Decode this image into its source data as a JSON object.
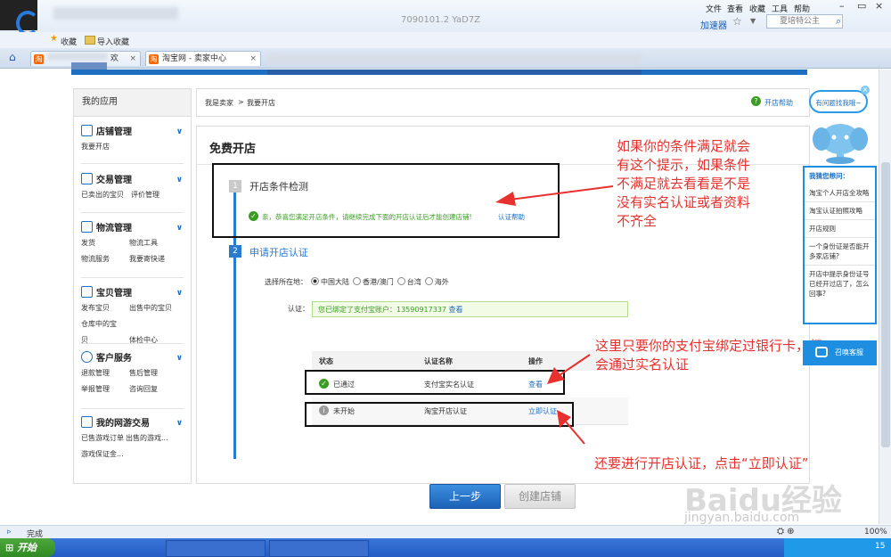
{
  "browser": {
    "menu": [
      "文件",
      "查看",
      "收藏",
      "工具",
      "帮助"
    ],
    "address_partial": "7090101.2 YaD7Z",
    "accelerator_label": "加速器",
    "search_placeholder": "夏培特公主",
    "favorites": [
      "收藏",
      "导入收藏"
    ],
    "tabs": [
      {
        "label": "",
        "active": false
      },
      {
        "label": "欢",
        "active": false
      },
      {
        "label": "淘宝网 - 卖家中心",
        "active": true
      }
    ],
    "status_text": "完成",
    "zoom": "100%"
  },
  "taskbar": {
    "start_label": "开始",
    "clock": "15"
  },
  "sidebar": {
    "title": "我的应用",
    "sections": [
      {
        "title": "店铺管理",
        "links": [
          "我要开店"
        ]
      },
      {
        "title": "交易管理",
        "links": [
          "已卖出的宝贝",
          "评价管理"
        ]
      },
      {
        "title": "物流管理",
        "links": [
          "发货",
          "物流工具",
          "物流服务",
          "我要寄快递"
        ]
      },
      {
        "title": "宝贝管理",
        "links": [
          "发布宝贝",
          "出售中的宝贝",
          "仓库中的宝贝",
          "体检中心"
        ]
      },
      {
        "title": "客户服务",
        "links": [
          "退款管理",
          "售后管理",
          "举报管理",
          "咨询回复"
        ]
      },
      {
        "title": "我的网游交易",
        "links": [
          "已售游戏订单",
          "出售的游戏...",
          "游戏保证金..."
        ]
      }
    ]
  },
  "breadcrumb": {
    "part1": "我是卖家",
    "sep": ">",
    "part2": "我要开店",
    "help_label": "开店帮助"
  },
  "main": {
    "title": "免费开店",
    "step1": {
      "num": "1",
      "title": "开店条件检测",
      "message": "亲，恭喜您满足开店条件，请继续完成下面的开店认证后才能创建店铺!",
      "link": "认证帮助"
    },
    "step2": {
      "num": "2",
      "title": "申请开店认证",
      "location_label": "选择所在地：",
      "locations": [
        "中国大陆",
        "香港/澳门",
        "台湾",
        "海外"
      ],
      "auth_label": "认证：",
      "alipay_text": "您已绑定了支付宝账户：13590917337",
      "alipay_link": "查看",
      "table": {
        "headers": [
          "状态",
          "认证名称",
          "操作"
        ],
        "rows": [
          {
            "status": "已通过",
            "name": "支付宝实名认证",
            "action": "查看",
            "icon": "check-circle-icon"
          },
          {
            "status": "未开始",
            "name": "淘宝开店认证",
            "action": "立即认证",
            "icon": "info-circle-icon"
          }
        ]
      }
    },
    "buttons": {
      "prev": "上一步",
      "create": "创建店铺"
    }
  },
  "annotations": {
    "a1": [
      "如果你的条件满足就会",
      "有这个提示，如果条件",
      "不满足就去看看是不是",
      "没有实名认证或者资料",
      "不齐全"
    ],
    "a2": [
      "这里只要你的支付宝绑定过银行卡，都",
      "会通过实名认证"
    ],
    "a3": "还要进行开店认证，点击“立即认证”"
  },
  "help_widget": {
    "bubble": "有问题找我哦~",
    "title": "我猜您想问：",
    "items": [
      "淘宝个人开店全攻略",
      "淘宝认证拍照攻略",
      "开店规则",
      "一个身份证是否能开多家店铺?",
      "开店中提示身份证号已经开过店了，怎么回事?"
    ],
    "service": "召唤客服"
  },
  "watermark": {
    "brand": "Baidu经验",
    "url": "jingyan.baidu.com"
  },
  "colors": {
    "accent": "#1e6fc1",
    "annotation": "#e8312f",
    "success": "#3a9d23",
    "success_bg": "#f2fbe6"
  }
}
